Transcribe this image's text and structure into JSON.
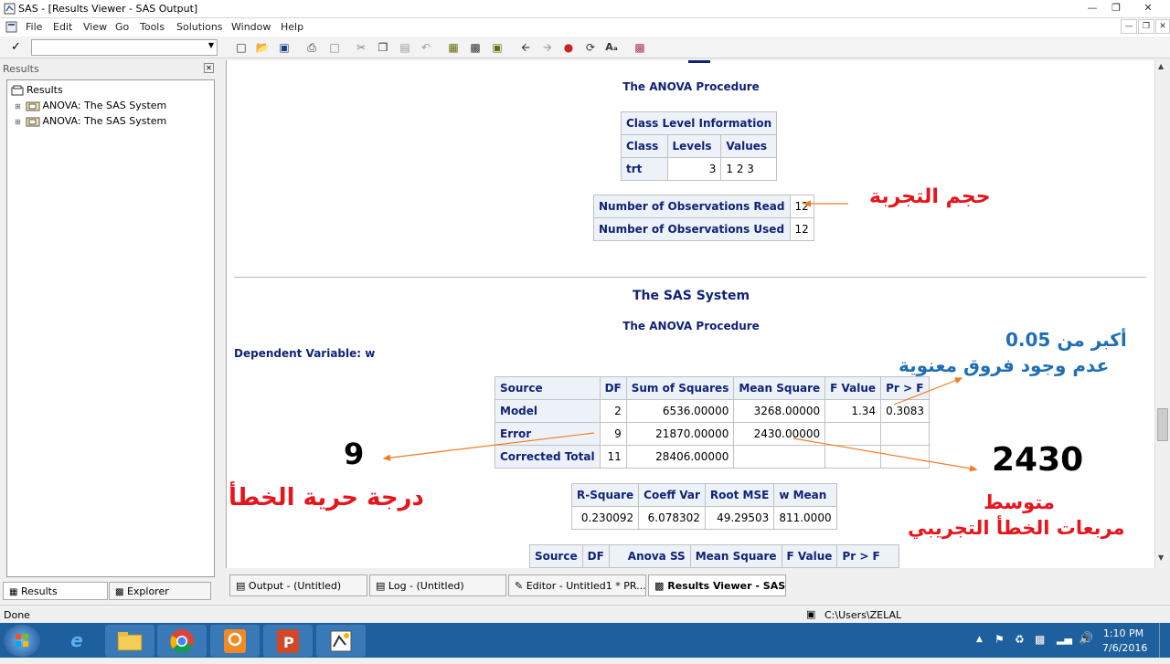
{
  "window": {
    "title": "SAS - [Results Viewer - SAS Output]"
  },
  "menu": [
    "File",
    "Edit",
    "View",
    "Go",
    "Tools",
    "Solutions",
    "Window",
    "Help"
  ],
  "left_pane": {
    "header": "Results",
    "tree": {
      "root": "Results",
      "items": [
        "ANOVA:  The SAS System",
        "ANOVA:  The SAS System"
      ]
    },
    "tabs": [
      "Results",
      "Explorer"
    ]
  },
  "output": {
    "procedure_title": "The ANOVA Procedure",
    "class_level": {
      "title": "Class Level Information",
      "headers": [
        "Class",
        "Levels",
        "Values"
      ],
      "row": [
        "trt",
        "3",
        "1 2 3"
      ]
    },
    "observations": [
      {
        "label": "Number of Observations Read",
        "value": "12"
      },
      {
        "label": "Number of Observations Used",
        "value": "12"
      }
    ],
    "system_title": "The SAS System",
    "procedure_title2": "The ANOVA Procedure",
    "dependent_variable": "Dependent Variable: w",
    "anova": {
      "headers": [
        "Source",
        "DF",
        "Sum of Squares",
        "Mean Square",
        "F Value",
        "Pr > F"
      ],
      "rows": [
        [
          "Model",
          "2",
          "6536.00000",
          "3268.00000",
          "1.34",
          "0.3083"
        ],
        [
          "Error",
          "9",
          "21870.00000",
          "2430.00000",
          "",
          ""
        ],
        [
          "Corrected Total",
          "11",
          "28406.00000",
          "",
          "",
          ""
        ]
      ]
    },
    "fit": {
      "headers": [
        "R-Square",
        "Coeff Var",
        "Root MSE",
        "w Mean"
      ],
      "row": [
        "0.230092",
        "6.078302",
        "49.29503",
        "811.0000"
      ]
    },
    "anova_ss_headers": [
      "Source",
      "DF",
      "Anova SS",
      "Mean Square",
      "F Value",
      "Pr > F"
    ]
  },
  "annotations": {
    "sample_size": "حجم التجربة",
    "pvalue_line1": "أكبر من 0.05",
    "pvalue_line2": "عدم وجود فروق معنوية",
    "df_value": "9",
    "df_label": "درجة حرية الخطأ",
    "mse_value": "2430",
    "mse_line1": "متوسط",
    "mse_line2": "مربعات الخطأ التجريبي",
    "red": "#e8141c",
    "blue": "#1f6fb5",
    "arrow": "#f07c22"
  },
  "sas_windows": [
    "Output - (Untitled)",
    "Log - (Untitled)",
    "Editor - Untitled1 *   PR...",
    "Results Viewer - SAS ..."
  ],
  "status": {
    "left": "Done",
    "path": "C:\\Users\\ZELAL"
  },
  "clock": {
    "time": "1:10 PM",
    "date": "7/6/2016"
  }
}
